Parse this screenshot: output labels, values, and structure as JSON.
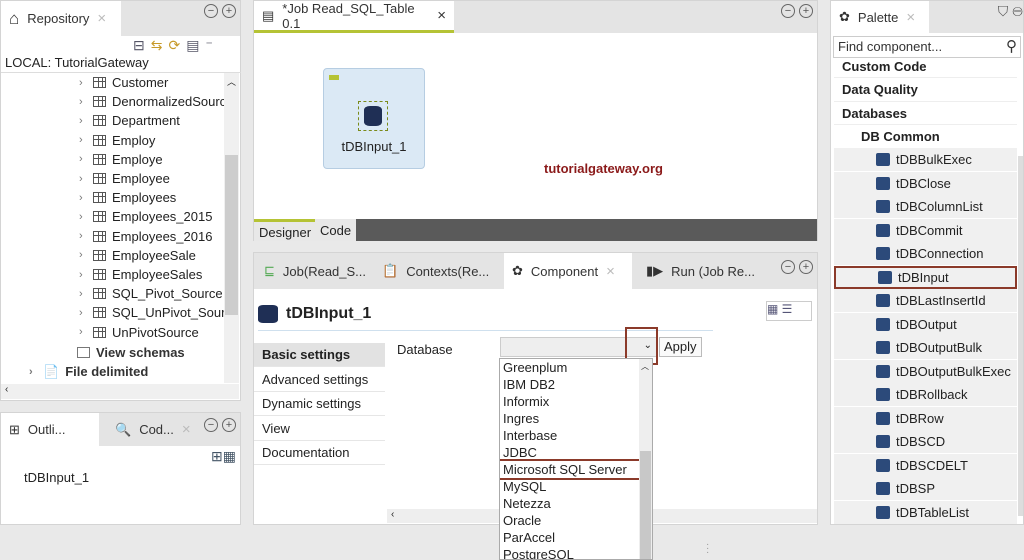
{
  "repository": {
    "tab_label": "Repository",
    "root_label": "LOCAL: TutorialGateway",
    "items": [
      "Customer",
      "DenormalizedSourc",
      "Department",
      "Employ",
      "Employe",
      "Employee",
      "Employees",
      "Employees_2015",
      "Employees_2016",
      "EmployeeSale",
      "EmployeeSales",
      "SQL_Pivot_Source",
      "SQL_UnPivot_Sourc",
      "UnPivotSource"
    ],
    "view_schemas": "View schemas",
    "file_delimited": "File delimited"
  },
  "outline": {
    "tabs": [
      "Outli...",
      "Cod..."
    ],
    "item": "tDBInput_1"
  },
  "job": {
    "tab_label": "*Job Read_SQL_Table 0.1",
    "component_label": "tDBInput_1",
    "watermark": "tutorialgateway.org",
    "bottom_tabs": [
      "Designer",
      "Code"
    ]
  },
  "component_panel": {
    "tabs": [
      "Job(Read_S...",
      "Contexts(Re...",
      "Component",
      "Run (Job Re..."
    ],
    "title": "tDBInput_1",
    "vertical_tabs": [
      "Basic settings",
      "Advanced settings",
      "Dynamic settings",
      "View",
      "Documentation"
    ],
    "database_label": "Database",
    "database_value": "",
    "apply_label": "Apply",
    "dropdown_options": [
      "Greenplum",
      "IBM DB2",
      "Informix",
      "Ingres",
      "Interbase",
      "JDBC",
      "Microsoft SQL Server",
      "MySQL",
      "Netezza",
      "Oracle",
      "ParAccel",
      "PostgreSQL"
    ],
    "highlighted_option": "Microsoft SQL Server"
  },
  "palette": {
    "tab_label": "Palette",
    "search_placeholder": "Find component...",
    "categories": [
      "Custom Code",
      "Data Quality",
      "Databases"
    ],
    "subcategory": "DB Common",
    "items": [
      "tDBBulkExec",
      "tDBClose",
      "tDBColumnList",
      "tDBCommit",
      "tDBConnection",
      "tDBInput",
      "tDBLastInsertId",
      "tDBOutput",
      "tDBOutputBulk",
      "tDBOutputBulkExec",
      "tDBRollback",
      "tDBRow",
      "tDBSCD",
      "tDBSCDELT",
      "tDBSP",
      "tDBTableList"
    ],
    "highlighted_item": "tDBInput"
  },
  "colors": {
    "highlight_border": "#8b3a2a",
    "watermark": "#8b1a1a",
    "active_tab_line": "#b5c335"
  }
}
